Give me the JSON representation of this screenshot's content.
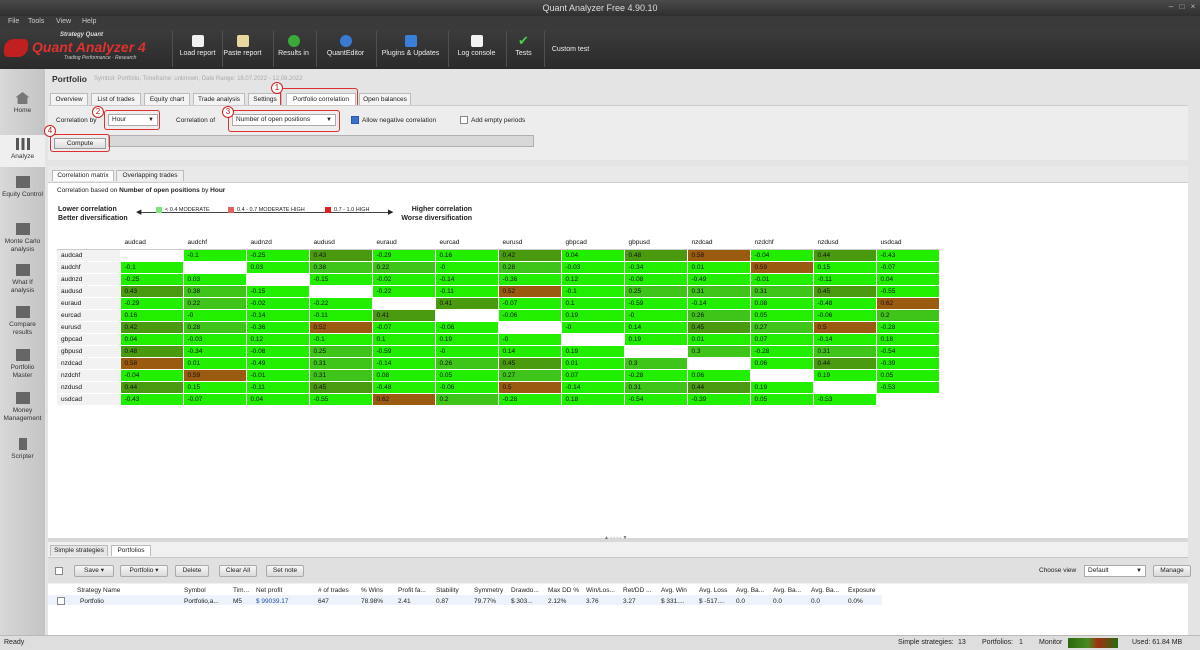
{
  "window": {
    "title": "Quant Analyzer Free 4.90.10"
  },
  "menu": [
    "File",
    "Tools",
    "View",
    "Help"
  ],
  "logo": {
    "brand": "Strategy Quant",
    "name": "Quant Analyzer 4",
    "tagline": "Trading Performance  ·  Research"
  },
  "toolbar": {
    "load": "Load report",
    "paste": "Paste report",
    "results": "Results in",
    "quanteditor": "QuantEditor",
    "plugins": "Plugins & Updates",
    "log": "Log console",
    "tests": "Tests",
    "custom": "Custom test"
  },
  "sidebar": [
    "Home",
    "Analyze",
    "Equity Control",
    "Monte Carlo analysis",
    "What If analysis",
    "Compare results",
    "Portfolio Master",
    "Money Management",
    "Scripter"
  ],
  "portfolio": {
    "title": "Portfolio",
    "subtitle": "Symbol: Portfolio, Timeframe: unknown, Date Range: 18.07.2022 - 12.08.2022"
  },
  "tabs": [
    "Overview",
    "List of trades",
    "Equity chart",
    "Trade analysis",
    "Settings",
    "Portfolio correlation",
    "Open balances"
  ],
  "settings": {
    "corr_by_label": "Correlation by",
    "corr_by_value": "Hour",
    "corr_of_label": "Correlation of",
    "corr_of_value": "Number of open positions",
    "allow_negative": "Allow negative correlation",
    "add_empty": "Add empty periods",
    "compute": "Compute"
  },
  "callouts": [
    "1",
    "2",
    "3",
    "4"
  ],
  "subtabs": [
    "Correlation matrix",
    "Overlapping trades"
  ],
  "matrix_info": {
    "desc_prefix": "Correlation based on ",
    "desc_metric": "Number of open positions",
    "desc_mid": " by ",
    "desc_by": "Hour",
    "lower1": "Lower correlation",
    "lower2": "Better diversification",
    "higher1": "Higher correlation",
    "higher2": "Worse diversification",
    "legend": [
      "< 0.4 MODERATE",
      "0.4 - 0.7 MODERATE HIGH",
      "0.7 - 1.0 HIGH"
    ],
    "legend_colors": [
      "#7fe27f",
      "#e06060",
      "#e02020"
    ]
  },
  "colors": {
    "green": "#22ee00",
    "olive": "#4a9a10",
    "brown": "#9a5a10",
    "rust": "#c04a10",
    "accent_red": "#e03030"
  },
  "symbols": [
    "audcad",
    "audchf",
    "audnzd",
    "audusd",
    "euraud",
    "eurcad",
    "eurusd",
    "gbpcad",
    "gbpusd",
    "nzdcad",
    "nzdchf",
    "nzdusd",
    "usdcad"
  ],
  "matrix": [
    [
      "",
      "-0.1",
      "-0.25",
      "0.43",
      "-0.29",
      "0.16",
      "0.42",
      "0.04",
      "0.48",
      "0.58",
      "-0.04",
      "0.44",
      "-0.43"
    ],
    [
      "-0.1",
      "",
      "0.03",
      "0.38",
      "0.22",
      "-0",
      "0.28",
      "-0.03",
      "-0.34",
      "0.01",
      "0.59",
      "0.15",
      "-0.07"
    ],
    [
      "-0.25",
      "0.03",
      "",
      "-0.15",
      "-0.02",
      "-0.14",
      "-0.36",
      "0.12",
      "-0.08",
      "-0.49",
      "-0.01",
      "-0.11",
      "0.04"
    ],
    [
      "0.43",
      "0.38",
      "-0.15",
      "",
      "-0.22",
      "-0.11",
      "0.52",
      "-0.1",
      "0.25",
      "0.31",
      "0.31",
      "0.45",
      "-0.55"
    ],
    [
      "-0.29",
      "0.22",
      "-0.02",
      "-0.22",
      "",
      "0.41",
      "-0.07",
      "0.1",
      "-0.59",
      "-0.14",
      "0.08",
      "-0.48",
      "0.62"
    ],
    [
      "0.16",
      "-0",
      "-0.14",
      "-0.11",
      "0.41",
      "",
      "-0.06",
      "0.19",
      "-0",
      "0.26",
      "0.05",
      "-0.06",
      "0.2"
    ],
    [
      "0.42",
      "0.28",
      "-0.36",
      "0.52",
      "-0.07",
      "-0.06",
      "",
      "-0",
      "0.14",
      "0.45",
      "0.27",
      "0.5",
      "-0.28"
    ],
    [
      "0.04",
      "-0.03",
      "0.12",
      "-0.1",
      "0.1",
      "0.19",
      "-0",
      "",
      "0.19",
      "0.01",
      "0.07",
      "-0.14",
      "0.18"
    ],
    [
      "0.48",
      "-0.34",
      "-0.08",
      "0.25",
      "-0.59",
      "-0",
      "0.14",
      "0.19",
      "",
      "0.3",
      "-0.28",
      "0.31",
      "-0.54"
    ],
    [
      "0.58",
      "0.01",
      "-0.49",
      "0.31",
      "-0.14",
      "0.26",
      "0.45",
      "0.01",
      "0.3",
      "",
      "0.06",
      "0.44",
      "-0.39"
    ],
    [
      "-0.04",
      "0.59",
      "-0.01",
      "0.31",
      "0.08",
      "0.05",
      "0.27",
      "0.07",
      "-0.28",
      "0.06",
      "",
      "0.19",
      "0.05"
    ],
    [
      "0.44",
      "0.15",
      "-0.11",
      "0.45",
      "-0.48",
      "-0.06",
      "0.5",
      "-0.14",
      "0.31",
      "0.44",
      "0.19",
      "",
      "-0.53"
    ],
    [
      "-0.43",
      "-0.07",
      "0.04",
      "-0.55",
      "0.62",
      "0.2",
      "-0.28",
      "0.18",
      "-0.54",
      "-0.39",
      "0.05",
      "-0.53",
      ""
    ]
  ],
  "bottom": {
    "tabs": [
      "Simple strategies",
      "Portfolios"
    ],
    "buttons": {
      "save": "Save",
      "portfolio": "Portfolio",
      "delete": "Delete",
      "clear_all": "Clear All",
      "set_note": "Set note",
      "manage": "Manage"
    },
    "choose_view": "Choose view",
    "view_value": "Default",
    "columns": [
      "Strategy Name",
      "Symbol",
      "Tim...",
      "Net profit",
      "# of trades",
      "% Wins",
      "Profit fa...",
      "Stability",
      "Symmetry",
      "Drawdo...",
      "Max DD %",
      "Win/Los...",
      "Ret/DD ...",
      "Avg. Win",
      "Avg. Loss",
      "Avg. Ba...",
      "Avg. Ba...",
      "Avg. Ba...",
      "Exposure"
    ],
    "row": [
      "Portfolio",
      "Portfolio,a...",
      "M5",
      "$ 99039.17",
      "647",
      "78.98%",
      "2.41",
      "0.87",
      "79.77%",
      "$ 303...",
      "2.12%",
      "3.76",
      "3.27",
      "$ 331....",
      "$ -517....",
      "0.0",
      "0.0",
      "0.0",
      "0.0%"
    ]
  },
  "status": {
    "ready": "Ready",
    "simple_label": "Simple strategies:",
    "simple_count": "13",
    "portfolios_label": "Portfolios:",
    "portfolios_count": "1",
    "monitor": "Monitor",
    "used": "Used: 61.84 MB"
  }
}
